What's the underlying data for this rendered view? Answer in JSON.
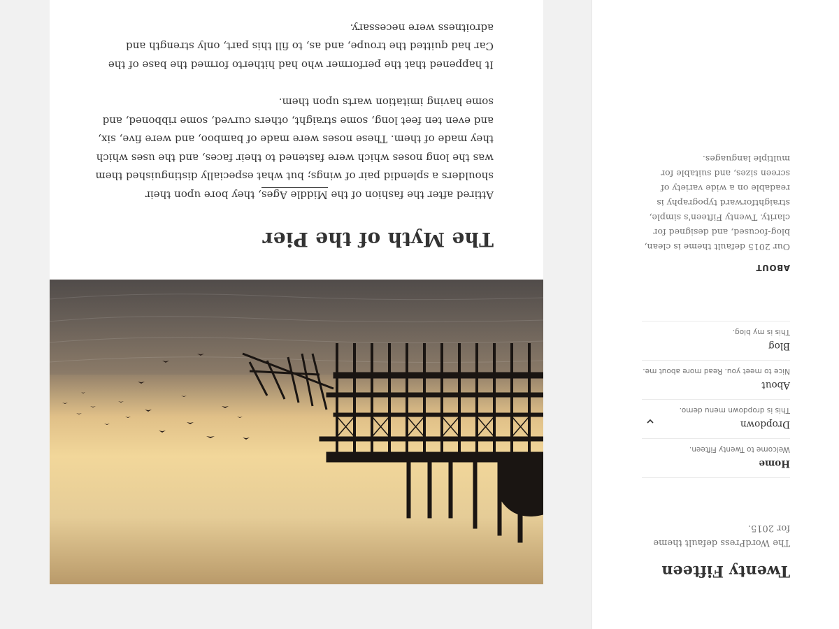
{
  "site": {
    "title": "Twenty Fifteen",
    "description": "The WordPress default theme for 2015."
  },
  "nav": {
    "items": [
      {
        "label": "Home",
        "description": "Welcome to Twenty Fifteen.",
        "current": true
      },
      {
        "label": "Dropdown",
        "description": "This is dropdown menu demo.",
        "has_children": true
      },
      {
        "label": "About",
        "description": "Nice to meet you. Read more about me."
      },
      {
        "label": "Blog",
        "description": "This is my blog."
      }
    ]
  },
  "widget": {
    "title": "ABOUT",
    "text": "Our 2015 default theme is clean, blog-focused, and designed for clarity. Twenty Fifteen's simple, straightforward typography is readable on a wide variety of screen sizes, and suitable for multiple languages."
  },
  "post": {
    "title": "The Myth of the Pier",
    "para1_before": "Attired after the fashion of the ",
    "para1_link": "Middle Ages",
    "para1_after": ", they bore upon their shoulders a splendid pair of wings; but what especially distinguished them was the long noses which were fastened to their faces, and the uses which they made of them. These noses were made of bamboo, and were five, six, and even ten feet long, some straight, others curved, some ribboned, and some having imitation warts upon them.",
    "para2": "It happened that the performer who had hitherto formed the base of the Car had quitted the troupe, and as, to fill this part, only strength and adroitness were necessary."
  },
  "image": {
    "subject": "pier-at-sunset-photo"
  },
  "colors": {
    "page_bg": "#f1f1f1",
    "card_bg": "#ffffff",
    "text": "#333333",
    "muted": "#707070",
    "divider": "#eaeaea"
  }
}
